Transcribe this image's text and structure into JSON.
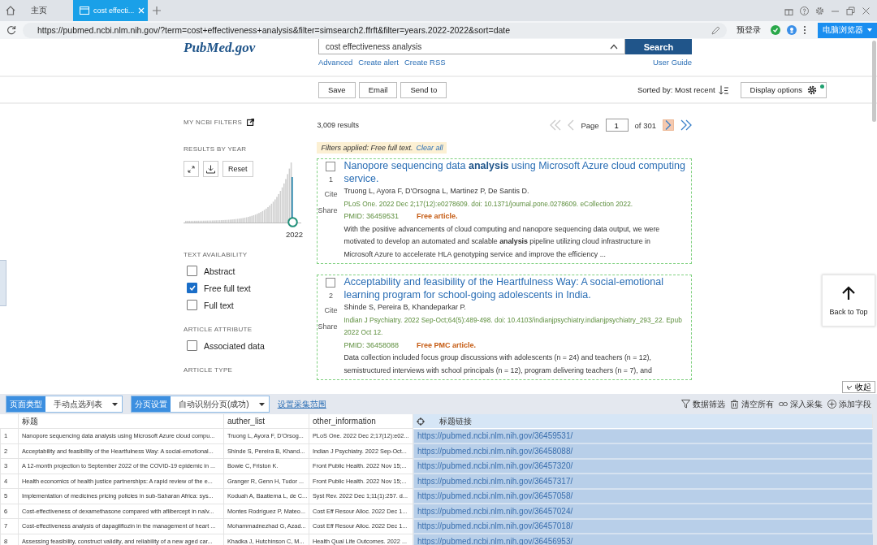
{
  "browser": {
    "tabs": [
      {
        "label": "主页",
        "selected": false
      },
      {
        "label": "cost effecti...",
        "selected": true
      }
    ],
    "url": "https://pubmed.ncbi.nlm.nih.gov/?term=cost+effectiveness+analysis&filter=simsearch2.ffrft&filter=years.2022-2022&sort=date",
    "login": "预登录",
    "mode_button": "电脑浏览器"
  },
  "pubmed": {
    "logo": "PubMed.gov",
    "search": {
      "value": "cost effectiveness analysis",
      "button": "Search"
    },
    "search_links": [
      "Advanced",
      "Create alert",
      "Create RSS"
    ],
    "user_guide": "User Guide",
    "actions": [
      "Save",
      "Email",
      "Send to"
    ],
    "sort": "Sorted by: Most recent",
    "display_options": "Display options",
    "sidebar": {
      "my_filters": "MY NCBI FILTERS",
      "results_by_year": "RESULTS BY YEAR",
      "reset": "Reset",
      "year": "2022",
      "sections": [
        {
          "title": "TEXT AVAILABILITY",
          "options": [
            {
              "label": "Abstract",
              "checked": false
            },
            {
              "label": "Free full text",
              "checked": true
            },
            {
              "label": "Full text",
              "checked": false
            }
          ]
        },
        {
          "title": "ARTICLE ATTRIBUTE",
          "options": [
            {
              "label": "Associated data",
              "checked": false
            }
          ]
        },
        {
          "title": "ARTICLE TYPE"
        }
      ]
    },
    "results_count": "3,009 results",
    "pagination": {
      "label": "Page",
      "page": "1",
      "total": "of 301"
    },
    "filters_applied": "Filters applied: Free full text.",
    "clear_all": "Clear all",
    "articles": [
      {
        "number": "1",
        "selected": false,
        "cite": "Cite",
        "share": "Share",
        "title": "Nanopore sequencing data **analysis** using Microsoft Azure cloud computing service.",
        "authors": "Truong L, Ayora F, D'Orsogna L, Martinez P, De Santis D.",
        "citation": "PLoS One. 2022 Dec 2;17(12):e0278609. doi: 10.1371/journal.pone.0278609. eCollection 2022.",
        "pmid": "PMID: 36459531",
        "free": "Free article.",
        "snippet": [
          "With the positive advancements of cloud computing and nanopore sequencing data output, we were",
          "motivated to develop an automated and scalable **analysis** pipeline utilizing cloud infrastructure in",
          "Microsoft Azure to accelerate HLA genotyping service and improve the efficiency ..."
        ]
      },
      {
        "number": "2",
        "selected": false,
        "cite": "Cite",
        "share": "Share",
        "title": "Acceptability and feasibility of the Heartfulness Way: A social-emotional learning program for school-going adolescents in India.",
        "authors": "Shinde S, Pereira B, Khandeparkar P.",
        "citation": "Indian J Psychiatry. 2022 Sep-Oct;64(5):489-498. doi: 10.4103/indianjpsychiatry.indianjpsychiatry_293_22. Epub 2022 Oct 12.",
        "pmid": "PMID: 36458088",
        "free": "Free PMC article.",
        "snippet": [
          "Data collection included focus group discussions with adolescents (n = 24) and teachers (n = 12),",
          "semistructured interviews with school principals (n = 12), program delivering teachers (n = 7), and"
        ]
      }
    ],
    "back_to_top": "Back to Top",
    "collapse": "收起"
  },
  "collector": {
    "page_type": {
      "label": "页面类型",
      "value": "手动点选列表"
    },
    "paging": {
      "label": "分页设置",
      "value": "自动识别分页(成功)"
    },
    "range_link": "设置采集范围",
    "tools": [
      {
        "kind": "filter",
        "label": "数据筛选"
      },
      {
        "kind": "trash",
        "label": "清空所有"
      },
      {
        "kind": "link",
        "label": "深入采集"
      },
      {
        "kind": "add",
        "label": "添加字段"
      }
    ],
    "table": {
      "columns": [
        {
          "label": "标题",
          "selected": false
        },
        {
          "label": "auther_list",
          "selected": false
        },
        {
          "label": "other_information",
          "selected": false
        },
        {
          "label": "标题链接",
          "selected": true
        }
      ],
      "rows": [
        {
          "index": "1",
          "cells": [
            "Nanopore sequencing data analysis using Microsoft Azure cloud compu...",
            "Truong L, Ayora F, D'Orsog...",
            "PLoS One. 2022 Dec 2;17(12):e02...",
            "https://pubmed.ncbi.nlm.nih.gov/36459531/"
          ]
        },
        {
          "index": "2",
          "cells": [
            "Acceptability and feasibility of the Heartfulness Way: A social-emotional...",
            "Shinde S, Pereira B, Khand...",
            "Indian J Psychiatry. 2022 Sep-Oct...",
            "https://pubmed.ncbi.nlm.nih.gov/36458088/"
          ]
        },
        {
          "index": "3",
          "cells": [
            "A 12-month projection to September 2022 of the COVID-19 epidemic in ...",
            "Bowie C, Friston K.",
            "Front Public Health. 2022 Nov 15;...",
            "https://pubmed.ncbi.nlm.nih.gov/36457320/"
          ]
        },
        {
          "index": "4",
          "cells": [
            "Health economics of health justice partnerships: A rapid review of the e...",
            "Granger R, Genn H, Tudor ...",
            "Front Public Health. 2022 Nov 15;...",
            "https://pubmed.ncbi.nlm.nih.gov/36457317/"
          ]
        },
        {
          "index": "5",
          "cells": [
            "Implementation of medicines pricing policies in sub-Saharan Africa: sys...",
            "Koduah A, Baatiema L, de C...",
            "Syst Rev. 2022 Dec 1;11(1):257. d...",
            "https://pubmed.ncbi.nlm.nih.gov/36457058/"
          ]
        },
        {
          "index": "6",
          "cells": [
            "Cost-effectiveness of dexamethasone compared with aflibercept in naïv...",
            "Montes Rodríguez P, Mateo...",
            "Cost Eff Resour Alloc. 2022 Dec 1...",
            "https://pubmed.ncbi.nlm.nih.gov/36457024/"
          ]
        },
        {
          "index": "7",
          "cells": [
            "Cost-effectiveness analysis of dapagliflozin in the management of heart ...",
            "Mohammadnezhad G, Azad...",
            "Cost Eff Resour Alloc. 2022 Dec 1...",
            "https://pubmed.ncbi.nlm.nih.gov/36457018/"
          ]
        },
        {
          "index": "8",
          "cells": [
            "Assessing feasibility, construct validity, and reliability of a new aged car...",
            "Khadka J, Hutchinson C, M...",
            "Health Qual Life Outcomes. 2022 ...",
            "https://pubmed.ncbi.nlm.nih.gov/36456953/"
          ]
        }
      ]
    }
  }
}
